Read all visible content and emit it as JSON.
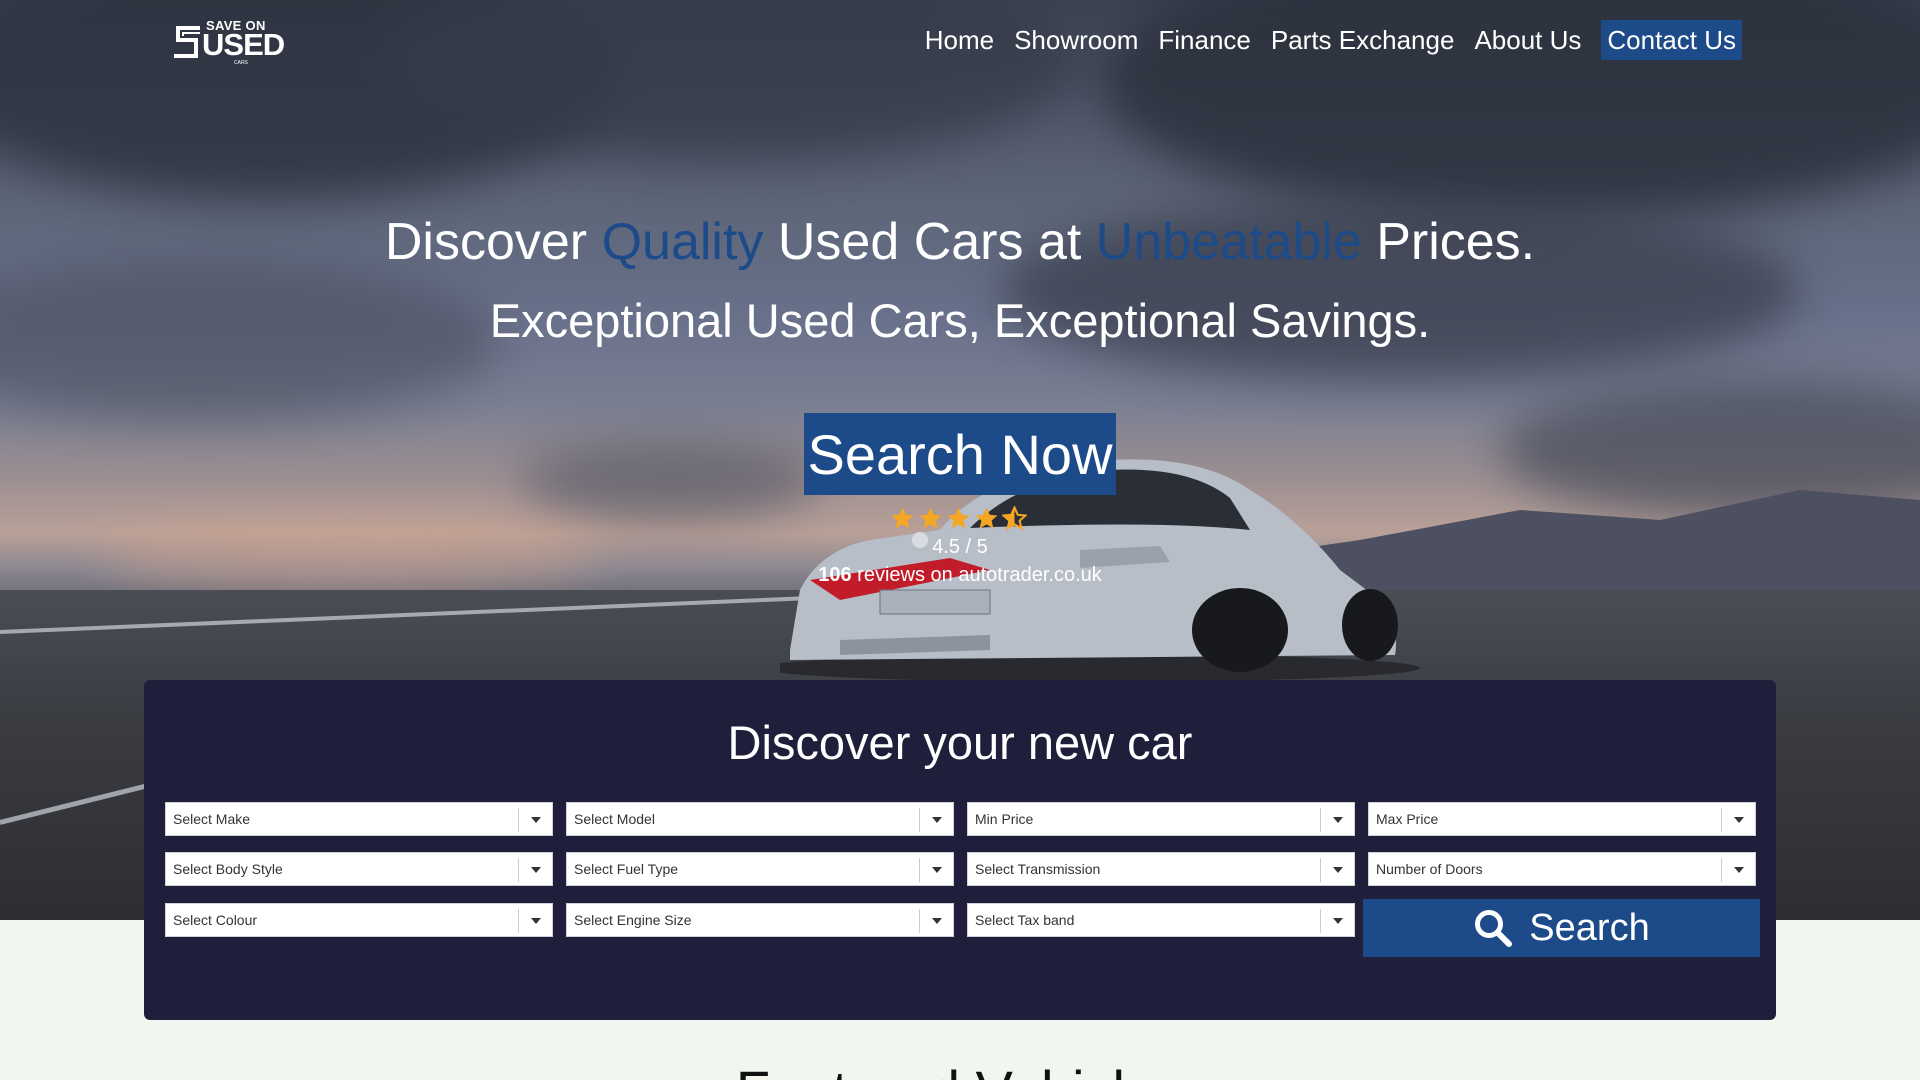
{
  "brand": {
    "logo_top": "SAVE ON",
    "logo_main": "USED",
    "logo_sub": "CARS"
  },
  "nav": {
    "items": [
      "Home",
      "Showroom",
      "Finance",
      "Parts Exchange",
      "About Us"
    ],
    "contact": "Contact Us"
  },
  "hero": {
    "headline_part1": "Discover ",
    "headline_accent1": "Quality",
    "headline_part2": " Used Cars at ",
    "headline_accent2": "Unbeatable",
    "headline_part3": " Prices.",
    "subline": "Exceptional Used Cars, Exceptional Savings.",
    "cta": "Search Now",
    "rating_value": 4.5,
    "rating_text": "4.5 / 5",
    "review_count": "106",
    "review_source": " reviews on autotrader.co.uk",
    "accent_color": "#1d4a88",
    "star_color": "#f5a623"
  },
  "search_panel": {
    "title": "Discover your new car",
    "selects": [
      "Select Make",
      "Select Model",
      "Min Price",
      "Max Price",
      "Select Body Style",
      "Select Fuel Type",
      "Select Transmission",
      "Number of Doors",
      "Select Colour",
      "Select Engine Size",
      "Select Tax band"
    ],
    "search_button": "Search",
    "search_icon": "search-icon",
    "panel_color": "#1f1f3b"
  },
  "featured": {
    "heading": "Featured Vehicles"
  }
}
